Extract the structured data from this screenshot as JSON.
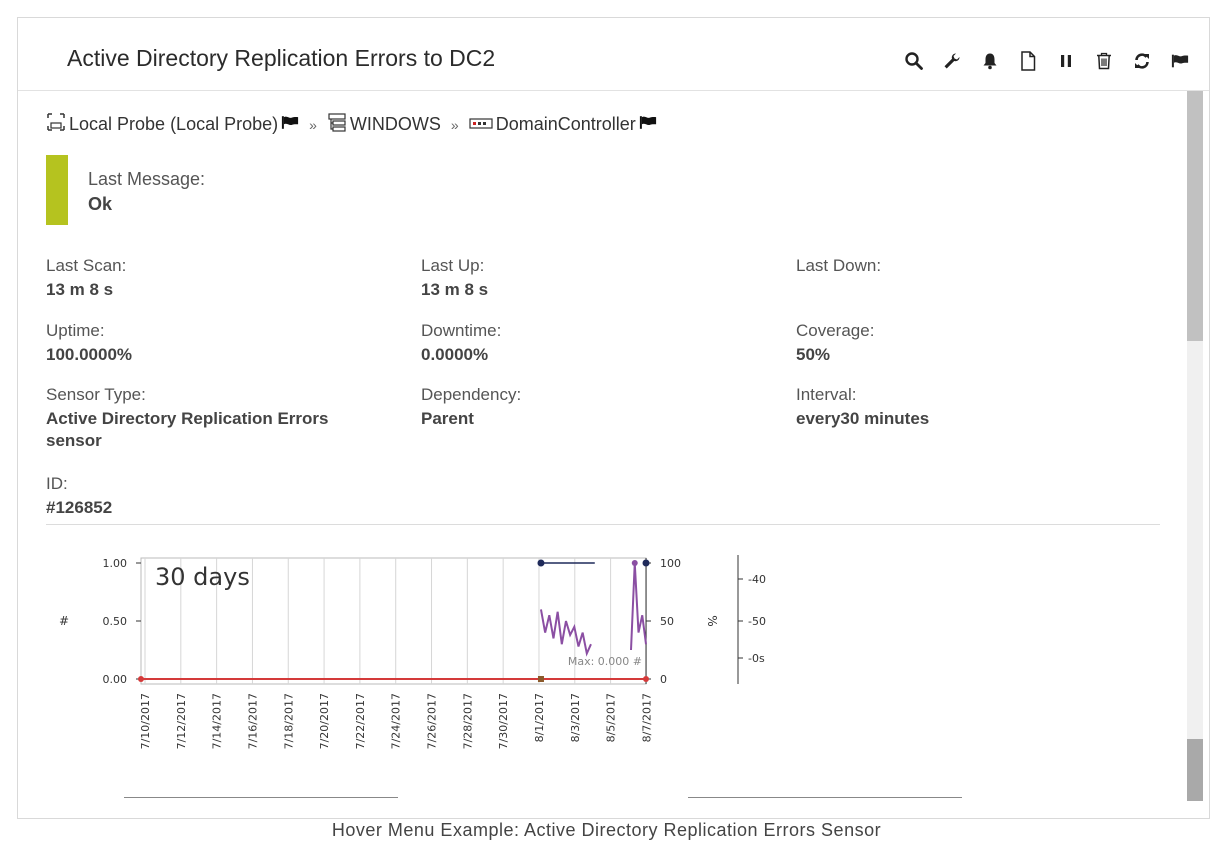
{
  "window": {
    "title": "Active Directory Replication Errors to DC2"
  },
  "toolbar": {
    "icons": [
      "search-icon",
      "wrench-icon",
      "bell-icon",
      "page-icon",
      "pause-icon",
      "trash-icon",
      "refresh-icon",
      "flag-icon"
    ]
  },
  "breadcrumb": {
    "probe": "Local Probe (Local Probe)",
    "group": "WINDOWS",
    "device": "DomainController",
    "sep": "»"
  },
  "status": {
    "label": "Last Message:",
    "value": "Ok",
    "color": "#b5c31f"
  },
  "fields": {
    "last_scan": {
      "label": "Last Scan:",
      "value": "13 m 8 s"
    },
    "last_up": {
      "label": "Last Up:",
      "value": "13 m 8 s"
    },
    "last_down": {
      "label": "Last Down:",
      "value": ""
    },
    "uptime": {
      "label": "Uptime:",
      "value": "100.0000%"
    },
    "downtime": {
      "label": "Downtime:",
      "value": "0.0000%"
    },
    "coverage": {
      "label": "Coverage:",
      "value": "50%"
    },
    "sensor_type": {
      "label": "Sensor Type:",
      "value_line1": "Active Directory Replication Errors",
      "value_line2": "sensor"
    },
    "dependency": {
      "label": "Dependency:",
      "value": "Parent"
    },
    "interval": {
      "label": "Interval:",
      "value": "every30 minutes"
    },
    "id": {
      "label": "ID:",
      "value": "#126852"
    }
  },
  "chart_data": {
    "type": "line",
    "title": "30 days",
    "ylabel_left": "#",
    "ylabel_right": "%",
    "left_ticks": [
      "1.00",
      "0.50",
      "0.00"
    ],
    "right_ticks": [
      "100",
      "50",
      "0"
    ],
    "far_right_ticks": [
      "-40s",
      "-50s",
      "-0s"
    ],
    "x_ticks": [
      "7/10/2017",
      "7/12/2017",
      "7/14/2017",
      "7/16/2017",
      "7/18/2017",
      "7/20/2017",
      "7/22/2017",
      "7/24/2017",
      "7/26/2017",
      "7/28/2017",
      "7/30/2017",
      "8/1/2017",
      "8/3/2017",
      "8/5/2017",
      "8/7/2017"
    ],
    "annotation": "Max: 0.000 #",
    "series": [
      {
        "values": [
          0,
          0
        ],
        "color": "#d43a3a"
      },
      {
        "values": [
          60,
          40,
          55,
          35,
          58,
          30,
          50,
          38,
          45,
          28,
          40,
          22,
          30,
          25,
          100,
          40,
          55,
          30
        ],
        "color": "#8b4fa3"
      },
      {
        "values": [
          100,
          100
        ],
        "color": "#1f2a5a"
      }
    ],
    "ylim_left": [
      0,
      1
    ],
    "ylim_right": [
      0,
      100
    ]
  },
  "caption": "Hover Menu Example: Active Directory Replication Errors Sensor"
}
